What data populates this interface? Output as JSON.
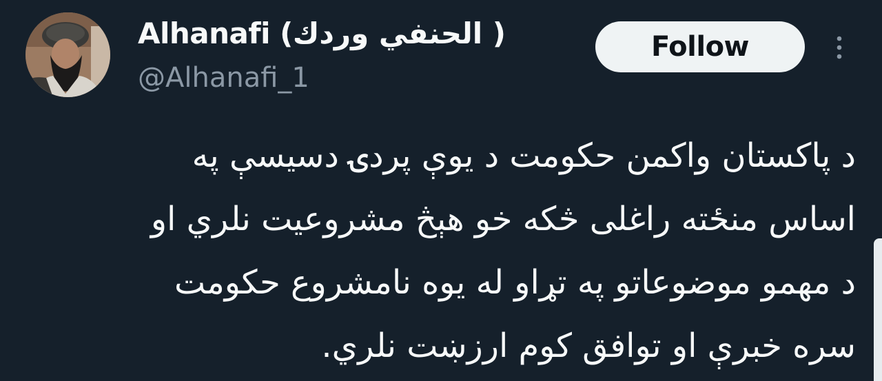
{
  "tweet": {
    "author": {
      "display_name": "Alhanafi (الحنفي وردك )",
      "handle": "@Alhanafi_1",
      "avatar_icon": "profile-photo"
    },
    "follow_label": "Follow",
    "more_icon": "vertical-dots-icon",
    "text_lines": [
      "د پاکستان واکمن حکومت د یوې پردۍ دسیسې په",
      "اساس منځته راغلی څکه خو هېڅ مشروعیت نلري او",
      "د مهمو موضوعاتو په تړاو له یوه نامشروع حکومت",
      "سره خبرې او توافق کوم ارزښت نلري."
    ]
  },
  "colors": {
    "background": "#15202b",
    "text_primary": "#f7f9f9",
    "text_secondary": "#8b98a5",
    "button_bg": "#eff3f4",
    "button_text": "#0f1419"
  }
}
